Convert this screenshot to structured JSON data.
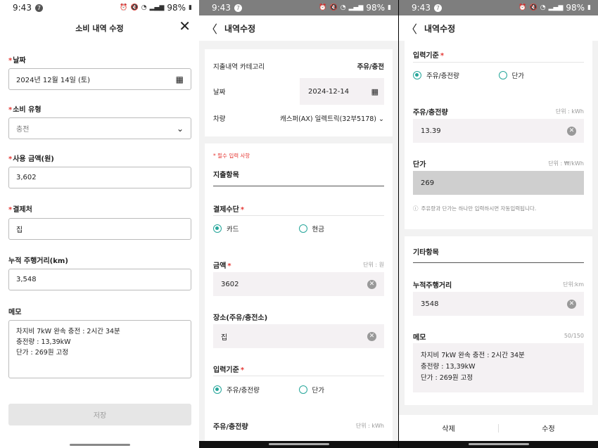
{
  "status": {
    "time": "9:43",
    "battery": "98%",
    "notif": "7"
  },
  "screen1": {
    "title": "소비 내역 수정",
    "date_label": "날짜",
    "date_value": "2024년 12월 14일 (토)",
    "type_label": "소비 유형",
    "type_value": "충전",
    "amount_label": "사용 금액(원)",
    "amount_value": "3,602",
    "payee_label": "결제처",
    "payee_value": "집",
    "mileage_label": "누적 주행거리(km)",
    "mileage_value": "3,548",
    "memo_label": "메모",
    "memo_value": "차지비 7kW 완속 충전 : 2시간 34분\n충전량 : 13,39kW\n단가 : 269원 고정",
    "save_label": "저장"
  },
  "screen2": {
    "header_title": "내역수정",
    "category_label": "지출내역 카테고리",
    "category_value": "주유/충전",
    "date_label": "날짜",
    "date_value": "2024-12-14",
    "vehicle_label": "차량",
    "vehicle_value": "캐스퍼(AX) 일렉트릭(32부5178)",
    "required_note": "* 필수 입력 사항",
    "section_title": "지출항목",
    "payment_label": "결제수단",
    "payment_options": [
      "카드",
      "현금"
    ],
    "amount_label": "금액",
    "amount_unit": "단위 : 원",
    "amount_value": "3602",
    "place_label": "장소(주유/충전소)",
    "place_value": "집",
    "basis_label": "입력기준",
    "basis_options": [
      "주유/충전량",
      "단가"
    ],
    "fuel_label": "주유/충전량",
    "fuel_unit": "단위 : kWh"
  },
  "screen3": {
    "header_title": "내역수정",
    "basis_label": "입력기준",
    "basis_options": [
      "주유/충전량",
      "단가"
    ],
    "fuel_label": "주유/충전량",
    "fuel_unit": "단위 : kWh",
    "fuel_value": "13.39",
    "price_label": "단가",
    "price_unit": "단위 : ₩/kWh",
    "price_value": "269",
    "hint": "주유량과 단가는 하나만 입력하시면 자동입력됩니다.",
    "other_title": "기타항목",
    "mileage_label": "누적주행거리",
    "mileage_unit": "단위:km",
    "mileage_value": "3548",
    "memo_label": "메모",
    "memo_count": "50/150",
    "memo_value": "차지비 7kW 완속 충전 : 2시간 34분\n충전량 : 13,39kW\n단가 : 269원 고정",
    "delete_label": "삭제",
    "edit_label": "수정"
  },
  "colors": {
    "accent": "#26a69a",
    "required": "#e53935"
  }
}
